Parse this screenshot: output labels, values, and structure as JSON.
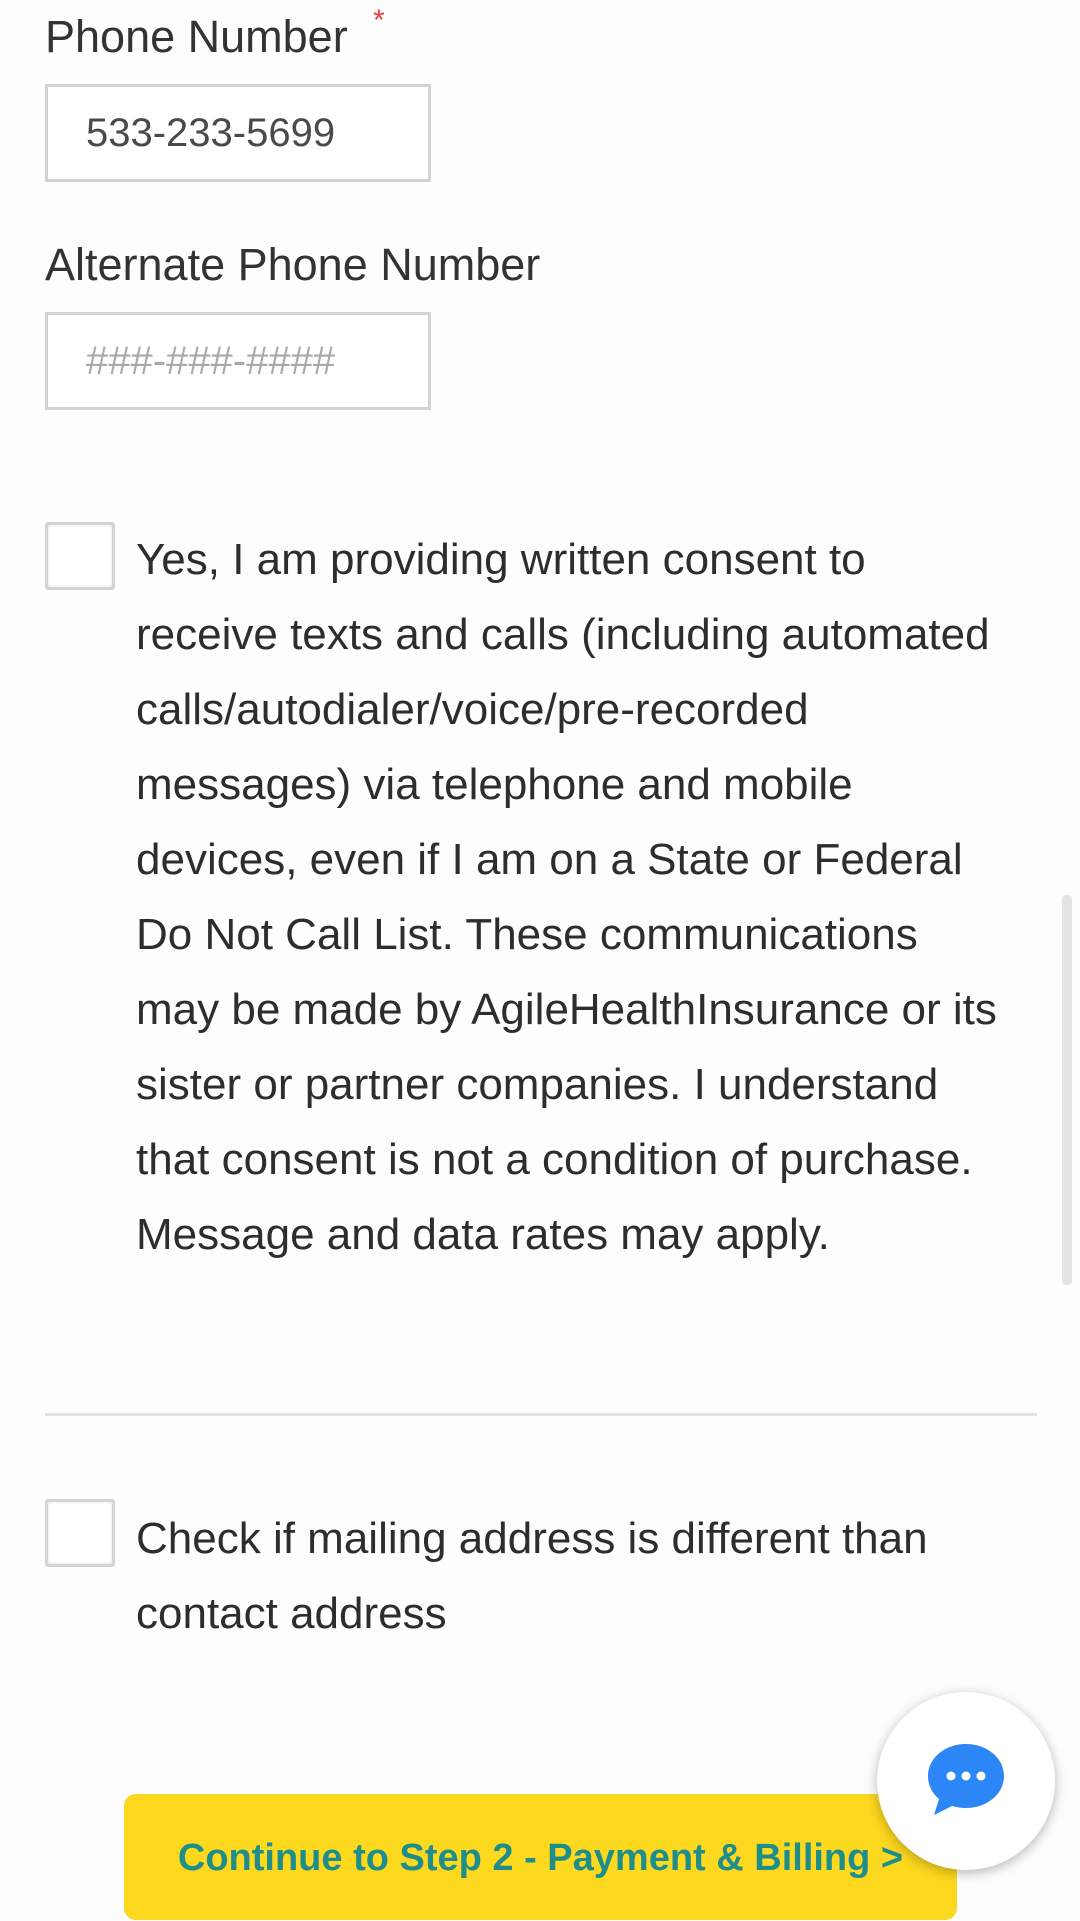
{
  "form": {
    "phone": {
      "label": "Phone Number",
      "required_mark": "*",
      "value": "533-233-5699"
    },
    "alt_phone": {
      "label": "Alternate Phone Number",
      "placeholder": "###-###-####",
      "value": ""
    },
    "consent": {
      "checked": false,
      "text": "Yes, I am providing written consent to receive texts and calls (including automated calls/autodialer/voice/pre-recorded messages) via telephone and mobile devices, even if I am on a State or Federal Do Not Call List. These communications may be made by AgileHealthInsurance or its sister or partner companies. I understand that consent is not a condition of purchase. Message and data rates may apply."
    },
    "mailing": {
      "checked": false,
      "text": "Check if mailing address is different than contact address"
    },
    "continue_button": {
      "label": "Continue to Step 2 - Payment & Billing >"
    }
  },
  "chat": {
    "icon": "chat-bubble-icon"
  },
  "colors": {
    "button_bg": "#fcd81f",
    "button_text": "#1f8e8a",
    "required_star": "#e8403a",
    "chat_icon": "#2d86f5"
  }
}
